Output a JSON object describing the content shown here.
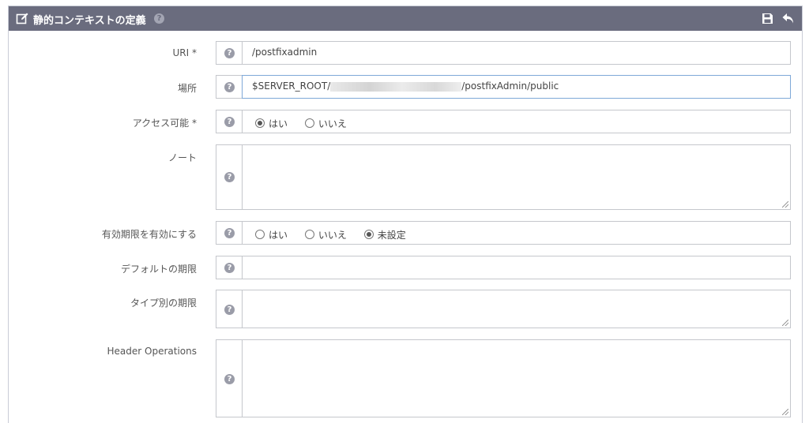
{
  "header": {
    "title": "静的コンテキストの定義",
    "help_icon": "question-circle",
    "actions": [
      {
        "name": "save",
        "icon": "floppy-disk"
      },
      {
        "name": "back",
        "icon": "undo-arrow"
      }
    ]
  },
  "colors": {
    "header_bg": "#6a6c7e",
    "border": "#c5c7cc",
    "focus_border": "#7fa9d8"
  },
  "fields": {
    "uri": {
      "label": "URI *",
      "value": "/postfixadmin"
    },
    "location": {
      "label": "場所",
      "value_prefix": "$SERVER_ROOT/",
      "value_suffix": "/postfixAdmin/public"
    },
    "accessible": {
      "label": "アクセス可能 *",
      "options": [
        "はい",
        "いいえ"
      ],
      "selected": "はい"
    },
    "note": {
      "label": "ノート",
      "value": ""
    },
    "enable_expires": {
      "label": "有効期限を有効にする",
      "options": [
        "はい",
        "いいえ",
        "未設定"
      ],
      "selected": "未設定"
    },
    "default_expires": {
      "label": "デフォルトの期限",
      "value": ""
    },
    "expires_by_type": {
      "label": "タイプ別の期限",
      "value": ""
    },
    "header_operations": {
      "label": "Header Operations",
      "value": ""
    }
  }
}
